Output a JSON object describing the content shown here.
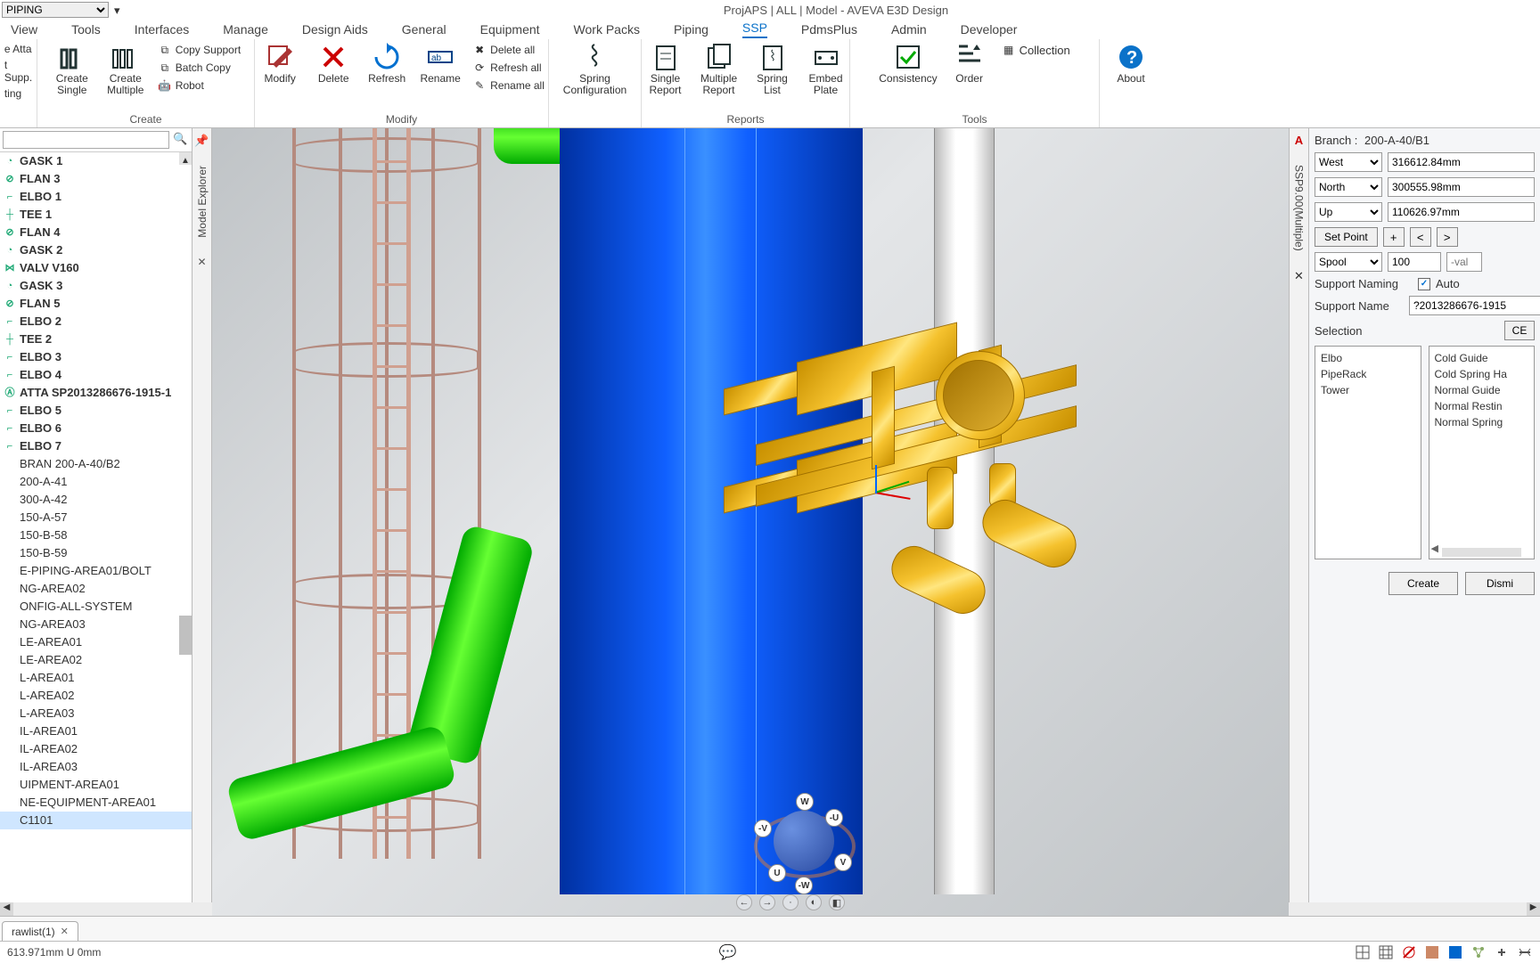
{
  "quickbar": {
    "filter": "PIPING"
  },
  "title": "ProjAPS | ALL | Model - AVEVA E3D Design",
  "menu": [
    "View",
    "Tools",
    "Interfaces",
    "Manage",
    "Design Aids",
    "General",
    "Equipment",
    "Work Packs",
    "Piping",
    "SSP",
    "PdmsPlus",
    "Admin",
    "Developer"
  ],
  "menu_active": "SSP",
  "left_partial_items": [
    "e Atta",
    "t Supp.",
    "ting"
  ],
  "ribbon": {
    "create": {
      "single": "Create\nSingle",
      "multiple": "Create\nMultiple",
      "copy": "Copy Support",
      "batch": "Batch Copy",
      "robot": "Robot",
      "group": "Create"
    },
    "modify": {
      "modify": "Modify",
      "delete": "Delete",
      "refresh": "Refresh",
      "rename": "Rename",
      "del_all": "Delete all",
      "ref_all": "Refresh all",
      "ren_all": "Rename all",
      "group": "Modify"
    },
    "spring": {
      "spring": "Spring\nConfiguration"
    },
    "reports": {
      "single": "Single\nReport",
      "multiple": "Multiple\nReport",
      "springlist": "Spring\nList",
      "plate": "Embed\nPlate",
      "group": "Reports"
    },
    "tools": {
      "consistency": "Consistency",
      "order": "Order",
      "collection": "Collection",
      "about": "About",
      "group": "Tools"
    }
  },
  "tree_items": [
    {
      "t": "GASK 1",
      "b": 1,
      "i": "g"
    },
    {
      "t": "FLAN 3",
      "b": 1,
      "i": "f"
    },
    {
      "t": "ELBO 1",
      "b": 1,
      "i": "e"
    },
    {
      "t": "TEE 1",
      "b": 1,
      "i": "t"
    },
    {
      "t": "FLAN 4",
      "b": 1,
      "i": "f"
    },
    {
      "t": "GASK 2",
      "b": 1,
      "i": "g"
    },
    {
      "t": "VALV V160",
      "b": 1,
      "i": "v"
    },
    {
      "t": "GASK 3",
      "b": 1,
      "i": "g"
    },
    {
      "t": "FLAN 5",
      "b": 1,
      "i": "f"
    },
    {
      "t": "ELBO 2",
      "b": 1,
      "i": "e"
    },
    {
      "t": "TEE 2",
      "b": 1,
      "i": "t"
    },
    {
      "t": "ELBO 3",
      "b": 1,
      "i": "e"
    },
    {
      "t": "ELBO 4",
      "b": 1,
      "i": "e"
    },
    {
      "t": "ATTA SP2013286676-1915-1",
      "b": 1,
      "i": "a"
    },
    {
      "t": "ELBO 5",
      "b": 1,
      "i": "e"
    },
    {
      "t": "ELBO 6",
      "b": 1,
      "i": "e"
    },
    {
      "t": "ELBO 7",
      "b": 1,
      "i": "e"
    },
    {
      "t": "BRAN 200-A-40/B2",
      "b": 0,
      "i": ""
    },
    {
      "t": "200-A-41",
      "b": 0,
      "i": ""
    },
    {
      "t": "300-A-42",
      "b": 0,
      "i": ""
    },
    {
      "t": "150-A-57",
      "b": 0,
      "i": ""
    },
    {
      "t": "150-B-58",
      "b": 0,
      "i": ""
    },
    {
      "t": "150-B-59",
      "b": 0,
      "i": ""
    },
    {
      "t": "E-PIPING-AREA01/BOLT",
      "b": 0,
      "i": ""
    },
    {
      "t": "NG-AREA02",
      "b": 0,
      "i": ""
    },
    {
      "t": "ONFIG-ALL-SYSTEM",
      "b": 0,
      "i": ""
    },
    {
      "t": "NG-AREA03",
      "b": 0,
      "i": ""
    },
    {
      "t": "LE-AREA01",
      "b": 0,
      "i": ""
    },
    {
      "t": "LE-AREA02",
      "b": 0,
      "i": ""
    },
    {
      "t": "L-AREA01",
      "b": 0,
      "i": ""
    },
    {
      "t": "L-AREA02",
      "b": 0,
      "i": ""
    },
    {
      "t": "L-AREA03",
      "b": 0,
      "i": ""
    },
    {
      "t": "IL-AREA01",
      "b": 0,
      "i": ""
    },
    {
      "t": "IL-AREA02",
      "b": 0,
      "i": ""
    },
    {
      "t": "IL-AREA03",
      "b": 0,
      "i": ""
    },
    {
      "t": "UIPMENT-AREA01",
      "b": 0,
      "i": ""
    },
    {
      "t": "NE-EQUIPMENT-AREA01",
      "b": 0,
      "i": ""
    },
    {
      "t": "C1101",
      "b": 0,
      "i": "",
      "sel": 1
    }
  ],
  "vert_tab_left": "Model Explorer",
  "vert_tab_right": "SSP9.00(Multiple)",
  "nav": {
    "W": "W",
    "U": "U",
    "V": "V",
    "mU": "-U",
    "mV": "-V",
    "mW": "-W"
  },
  "right": {
    "branch_label": "Branch :",
    "branch": "200-A-40/B1",
    "dirs": [
      {
        "d": "West",
        "v": "316612.84mm"
      },
      {
        "d": "North",
        "v": "300555.98mm"
      },
      {
        "d": "Up",
        "v": "110626.97mm"
      }
    ],
    "setpoint": "Set Point",
    "plus": "+",
    "lt": "<",
    "gt": ">",
    "spool_opt": "Spool",
    "spool_val": "100",
    "val_ph": "-val",
    "naming_label": "Support Naming",
    "auto": "Auto",
    "name_label": "Support Name",
    "name_val": "?2013286676-1915",
    "selection_label": "Selection",
    "ce": "CE",
    "list_a": [
      "Elbo",
      "PipeRack",
      "Tower"
    ],
    "list_b": [
      "Cold Guide",
      "Cold Spring Ha",
      "Normal Guide",
      "Normal Restin",
      "Normal Spring"
    ],
    "create": "Create",
    "dismiss": "Dismi"
  },
  "bottom_tab": "rawlist(1)",
  "status_left": "613.971mm U 0mm"
}
